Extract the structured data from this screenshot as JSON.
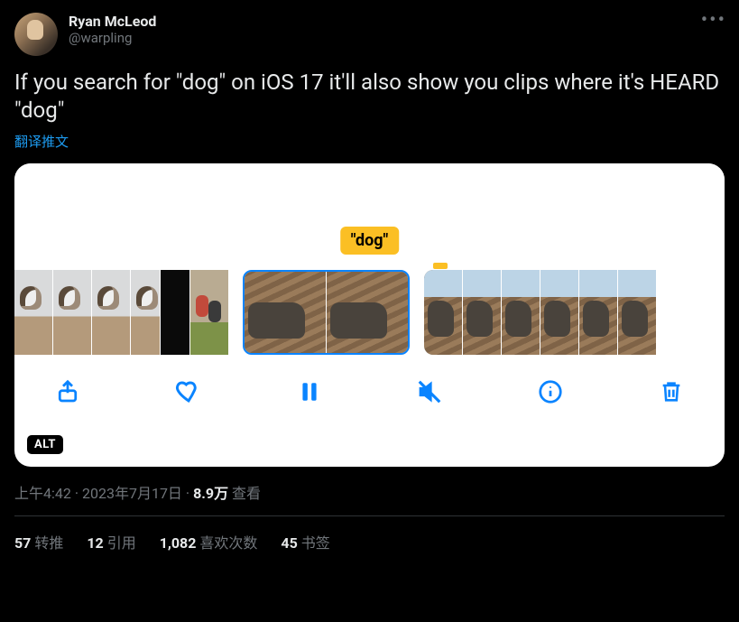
{
  "user": {
    "display_name": "Ryan McLeod",
    "handle": "@warpling"
  },
  "tweet": {
    "text": "If you search for \"dog\" on iOS 17 it'll also show you clips where it's HEARD \"dog\"",
    "translate_label": "翻译推文"
  },
  "media": {
    "search_label": "\"dog\"",
    "alt_badge": "ALT"
  },
  "meta": {
    "time": "上午4:42",
    "date": "2023年7月17日",
    "views_count": "8.9万",
    "views_label": "查看"
  },
  "stats": {
    "retweets_count": "57",
    "retweets_label": "转推",
    "quotes_count": "12",
    "quotes_label": "引用",
    "likes_count": "1,082",
    "likes_label": "喜欢次数",
    "bookmarks_count": "45",
    "bookmarks_label": "书签"
  }
}
